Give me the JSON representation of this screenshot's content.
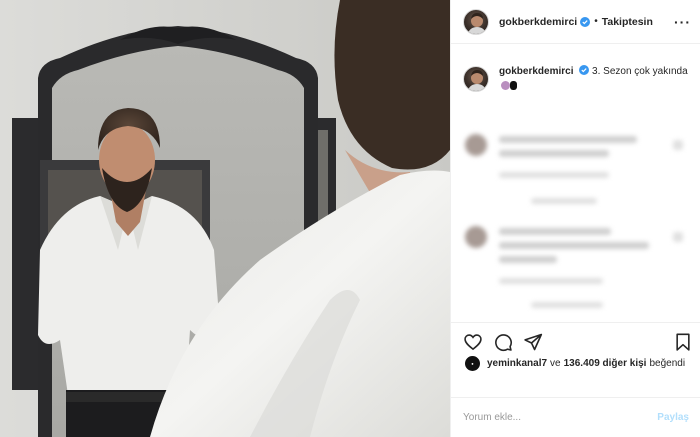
{
  "post": {
    "username": "gokberkdemirci",
    "follow_status": "Takiptesin",
    "caption_username": "gokberkdemirci",
    "caption_text": "3. Sezon çok yakında",
    "likes_user": "yeminkanal7",
    "likes_connector": "ve",
    "likes_count": "136.409 diğer kişi",
    "likes_suffix": "beğendi",
    "comment_placeholder": "Yorum ekle...",
    "post_button": "Paylaş"
  },
  "icons": {
    "verified": "verified-badge-icon",
    "more": "more-options-icon",
    "like": "heart-icon",
    "comment": "comment-bubble-icon",
    "share": "paper-plane-icon",
    "save": "bookmark-icon"
  },
  "colors": {
    "verified": "#3897f0",
    "text": "#262626",
    "muted": "#999999",
    "post_button_disabled": "#b2dffc",
    "divider": "#efefef"
  }
}
